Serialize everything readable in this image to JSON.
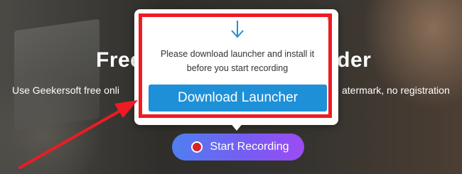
{
  "page": {
    "headline_left": "Free",
    "headline_right": "rder",
    "subline_left": "Use Geekersoft free onli",
    "subline_right": "atermark, no registration"
  },
  "record": {
    "label": "Start Recording"
  },
  "popup": {
    "message_line1": "Please download launcher and install it",
    "message_line2": "before you start recording",
    "download_label": "Download Launcher",
    "close_glyph": "×",
    "download_icon": "download-arrow-icon"
  },
  "colors": {
    "accent_blue": "#1e90d8",
    "annotation_red": "#ee1b24",
    "record_gradient_start": "#4f7ff0",
    "record_gradient_end": "#9b4cf2"
  }
}
